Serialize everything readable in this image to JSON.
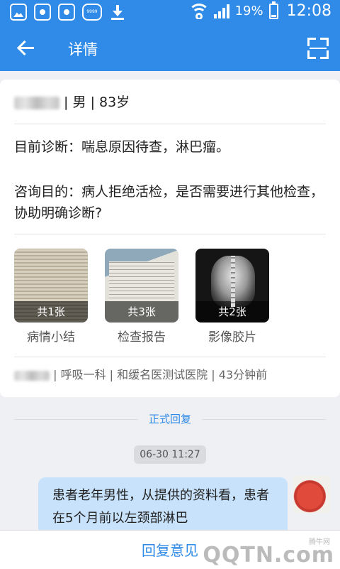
{
  "status_bar": {
    "battery_text": "19%",
    "time": "12:08",
    "notif_bubble_text": "9999"
  },
  "app_bar": {
    "title": "详情"
  },
  "patient": {
    "gender": "男",
    "age": "83岁",
    "sep": "|"
  },
  "diagnosis": {
    "text": "目前诊断：喘息原因待查，淋巴瘤。"
  },
  "purpose": {
    "text": "咨询目的：病人拒绝活检，是否需要进行其他检查，协助明确诊断?"
  },
  "attachments": [
    {
      "count": "共1张",
      "label": "病情小结"
    },
    {
      "count": "共3张",
      "label": "检查报告"
    },
    {
      "count": "共2张",
      "label": "影像胶片"
    }
  ],
  "meta": {
    "department": "呼吸一科",
    "hospital": "和缓名医测试医院",
    "time_ago": "43分钟前"
  },
  "reply_section": {
    "label": "正式回复",
    "timestamp": "06-30 11:27"
  },
  "message": {
    "text": "患者老年男性，从提供的资料看，患者在5个月前以左颈部淋巴"
  },
  "bottom": {
    "reply_button": "回复意见"
  },
  "watermark": {
    "small": "腾牛网",
    "big": "QQTN.com"
  }
}
